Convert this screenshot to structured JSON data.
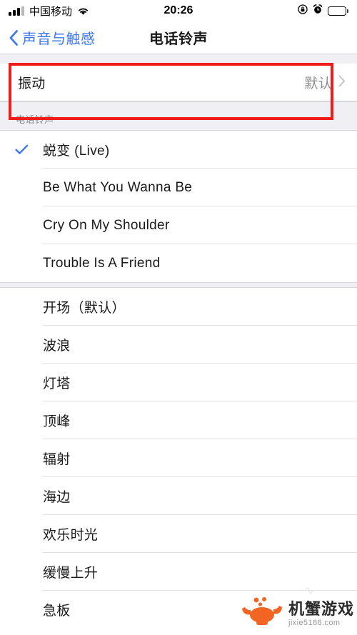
{
  "status_bar": {
    "carrier": "中国移动",
    "time": "20:26",
    "signal_icon": "signal-bars-icon",
    "wifi_icon": "wifi-icon",
    "rotation_lock_icon": "rotation-lock-icon",
    "alarm_icon": "alarm-clock-icon",
    "battery_icon": "battery-full-icon"
  },
  "nav": {
    "back_label": "声音与触感",
    "title": "电话铃声",
    "back_icon": "chevron-left-icon"
  },
  "vibration_row": {
    "label": "振动",
    "value": "默认",
    "chevron_icon": "chevron-right-icon"
  },
  "ringtone_section": {
    "header": "电话铃声"
  },
  "custom_tones": [
    {
      "label": "蜕变 (Live)",
      "selected": true
    },
    {
      "label": "Be What You Wanna Be",
      "selected": false
    },
    {
      "label": "Cry On My Shoulder",
      "selected": false
    },
    {
      "label": "Trouble Is A Friend",
      "selected": false
    }
  ],
  "system_tones": [
    {
      "label": "开场（默认）",
      "selected": false
    },
    {
      "label": "波浪",
      "selected": false
    },
    {
      "label": "灯塔",
      "selected": false
    },
    {
      "label": "顶峰",
      "selected": false
    },
    {
      "label": "辐射",
      "selected": false
    },
    {
      "label": "海边",
      "selected": false
    },
    {
      "label": "欢乐时光",
      "selected": false
    },
    {
      "label": "缓慢上升",
      "selected": false
    },
    {
      "label": "急板",
      "selected": false
    }
  ],
  "watermark": {
    "name": "机蟹游戏",
    "url": "jixie5188.com",
    "icon": "crab-logo-icon",
    "color": "#f26522"
  },
  "annotation": {
    "shape": "red-rectangle-highlight",
    "color": "#f01c1c"
  },
  "colors": {
    "accent_blue": "#3b78f0",
    "group_background": "#efeff4",
    "separator": "#e2e2e5",
    "secondary_text": "#8c8c91"
  }
}
